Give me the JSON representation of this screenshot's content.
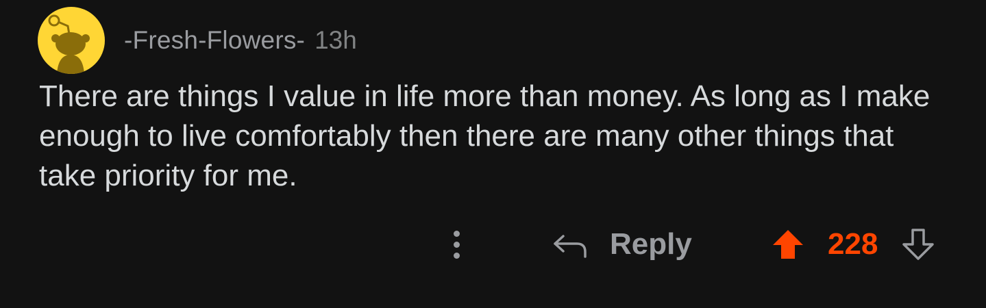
{
  "comment": {
    "author": "-Fresh-Flowers-",
    "time": "13h",
    "avatar_icon": "snoo-avatar-icon",
    "body": "There are things I value in life more than money. As long as I make enough to live comfortably then there are many other things that take priority for me."
  },
  "actions": {
    "more_icon": "more-vertical-icon",
    "reply_icon": "reply-arrow-icon",
    "reply_label": "Reply",
    "upvote_icon": "upvote-arrow-icon",
    "score": "228",
    "downvote_icon": "downvote-arrow-icon",
    "upvoted": true
  },
  "colors": {
    "background": "#121212",
    "avatar": "#ffd635",
    "upvote": "#ff4500",
    "text": "#d7dadc",
    "muted": "#9a9ca0"
  }
}
